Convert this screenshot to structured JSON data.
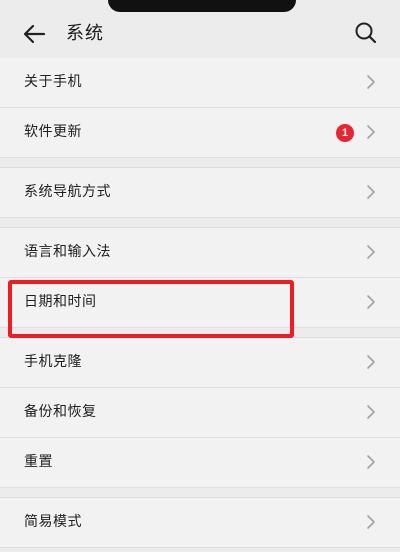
{
  "header": {
    "title": "系统",
    "back_icon": "back-arrow-icon",
    "search_icon": "search-icon"
  },
  "items": [
    {
      "label": "关于手机"
    },
    {
      "label": "软件更新",
      "badge": "1"
    },
    {
      "label": "系统导航方式"
    },
    {
      "label": "语言和输入法"
    },
    {
      "label": "日期和时间",
      "highlighted": true
    },
    {
      "label": "手机克隆"
    },
    {
      "label": "备份和恢复"
    },
    {
      "label": "重置"
    },
    {
      "label": "简易模式"
    }
  ],
  "colors": {
    "background": "#ececec",
    "row": "#f2f2f2",
    "badge": "#e8262f",
    "highlight": "#ee1c24"
  }
}
